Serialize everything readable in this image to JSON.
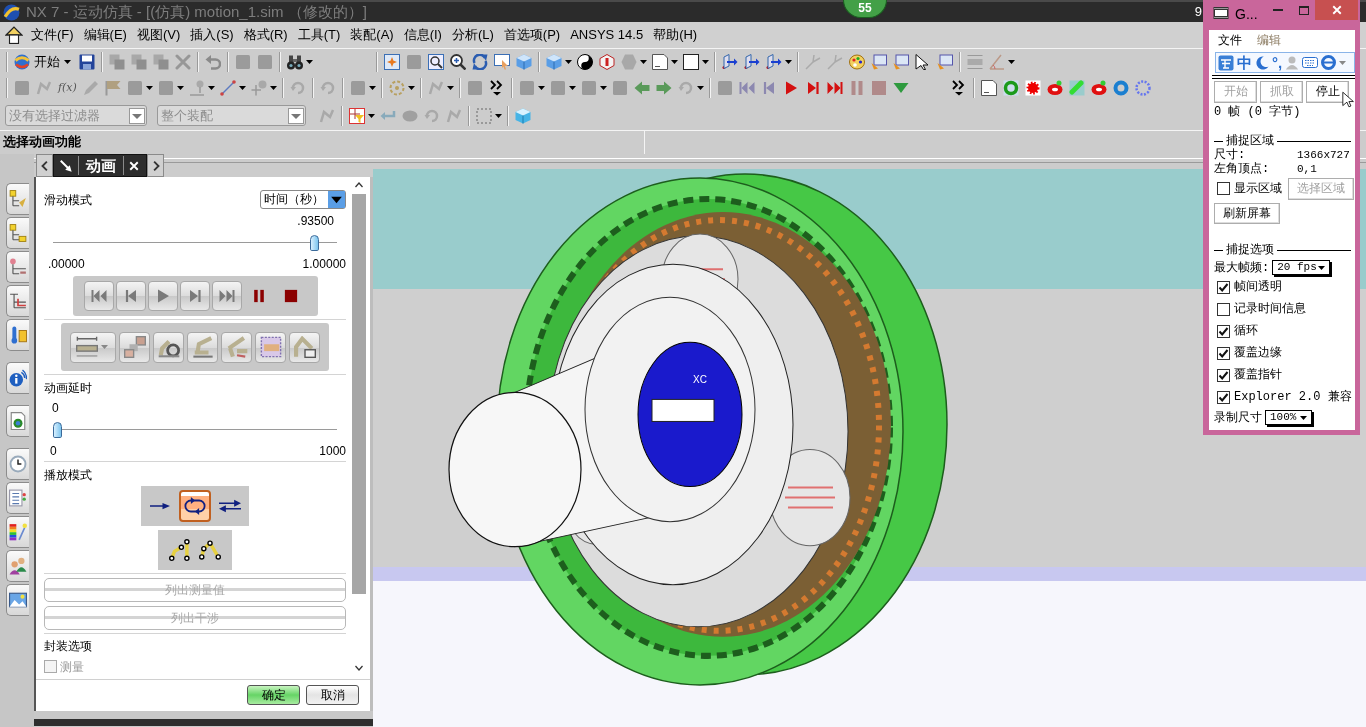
{
  "title_bar": {
    "title": "NX 7 - 运动仿真 - [(仿真) motion_1.sim （修改的）]",
    "badge": "55",
    "edge_text": "9"
  },
  "menu_bar": {
    "items": [
      "文件(F)",
      "编辑(E)",
      "视图(V)",
      "插入(S)",
      "格式(R)",
      "工具(T)",
      "装配(A)",
      "信息(I)",
      "分析(L)",
      "首选项(P)",
      "ANSYS 14.5",
      "帮助(H)"
    ]
  },
  "toolbar": {
    "start_button": "开始",
    "function_button": "f(x)",
    "filters": [
      {
        "value": "没有选择过滤器",
        "disabled": true
      },
      {
        "value": "整个装配",
        "disabled": true
      }
    ]
  },
  "cue_line": {
    "text": "选择动画功能"
  },
  "animation_dialog": {
    "title": "动画",
    "slide_mode": {
      "label": "滑动模式",
      "value": "时间（秒）"
    },
    "time_slider": {
      "reading": ".93500",
      "level": 0.935,
      "min_label": ".00000",
      "max_label": "1.00000"
    },
    "delay_label": "动画延时",
    "delay_slider": {
      "reading": "0",
      "level": 0,
      "min_label": "0",
      "max_label": "1000"
    },
    "playback_mode": {
      "label": "播放模式",
      "options": [
        {
          "kind": "once",
          "selected": false
        },
        {
          "kind": "loop",
          "selected": true
        },
        {
          "kind": "ping_pong",
          "selected": false
        }
      ]
    },
    "list_buttons": [
      {
        "label": "列出测量值",
        "disabled": true
      },
      {
        "label": "列出干涉",
        "disabled": true
      }
    ],
    "package_options": {
      "label": "封装选项",
      "checkboxes": [
        {
          "label": "测量",
          "checked": false,
          "disabled": true
        }
      ]
    },
    "actions": [
      {
        "label": "确定",
        "kind": "ok"
      },
      {
        "label": "取消",
        "kind": "cancel"
      }
    ]
  },
  "graphics": {
    "axis_label": "XC"
  },
  "recorder": {
    "title": "G...",
    "menu": [
      {
        "label": "文件",
        "disabled": false
      },
      {
        "label": "编辑",
        "disabled": true
      }
    ],
    "ime": {
      "mode": "中",
      "punctuation": "°,"
    },
    "buttons": [
      {
        "label": "开始",
        "disabled": true
      },
      {
        "label": "抓取",
        "disabled": true
      },
      {
        "label": "停止",
        "disabled": false
      }
    ],
    "status": "0 帧 (0 字节)",
    "capture_area": {
      "heading": "捕捉区域",
      "size_label": "尺寸:",
      "size": "1366x727",
      "origin_label": "左角顶点:",
      "origin": "0,1",
      "show_area": {
        "label": "显示区域",
        "checked": false
      },
      "select_button": {
        "label": "选择区域",
        "disabled": true
      },
      "refresh_button": "刷新屏幕"
    },
    "capture_options": {
      "heading": "捕捉选项",
      "fps_label": "最大帧频:",
      "fps": "20 fps",
      "options": [
        {
          "label": "帧间透明",
          "checked": true
        },
        {
          "label": "记录时间信息",
          "checked": false
        },
        {
          "label": "循环",
          "checked": true
        },
        {
          "label": "覆盖边缘",
          "checked": true
        },
        {
          "label": "覆盖指针",
          "checked": true
        },
        {
          "label": "Explorer 2.0 兼容",
          "checked": true
        }
      ],
      "size_label": "录制尺寸",
      "size": "100%"
    }
  }
}
